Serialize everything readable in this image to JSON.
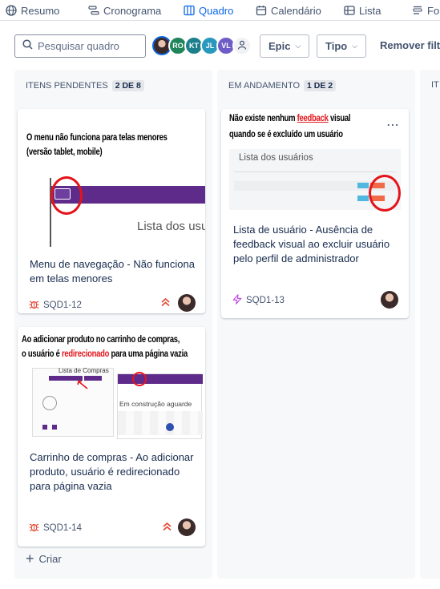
{
  "tabs": [
    {
      "label": "Resumo",
      "icon": "globe-icon"
    },
    {
      "label": "Cronograma",
      "icon": "timeline-icon"
    },
    {
      "label": "Quadro",
      "icon": "board-icon",
      "active": true
    },
    {
      "label": "Calendário",
      "icon": "calendar-icon"
    },
    {
      "label": "Lista",
      "icon": "list-icon"
    },
    {
      "label": "Form",
      "icon": "form-icon"
    }
  ],
  "filters": {
    "search_placeholder": "Pesquisar quadro",
    "avatars": [
      {
        "initials": "",
        "color": "#3b2a2a",
        "type": "photo"
      },
      {
        "initials": "RO",
        "color": "#1f845a"
      },
      {
        "initials": "KT",
        "color": "#1d7f8c"
      },
      {
        "initials": "JL",
        "color": "#2898bd"
      },
      {
        "initials": "VL",
        "color": "#6e5dc6"
      }
    ],
    "epic_label": "Epic",
    "tipo_label": "Tipo",
    "remover_label": "Remover filtr"
  },
  "columns": [
    {
      "title": "ITENS PENDENTES",
      "count": "2 DE 8",
      "create_label": "Criar",
      "cards": [
        {
          "thumb_line1": "O menu não funciona para telas menores",
          "thumb_line2": "(versão tablet, mobile)",
          "thumb_screen_text": "Lista dos usu",
          "title": "Menu de navegação - Não funciona em telas menores",
          "key": "SQD1-12",
          "type_icon": "bug-icon"
        },
        {
          "thumb_line1": "Ao adicionar produto no carrinho de compras,",
          "thumb_line2_a": "o usuário é ",
          "thumb_line2_red": "redirecionado",
          "thumb_line2_b": " para uma página vazia",
          "thumb_mini_title": "Lista de Compras",
          "thumb_mini_text": "Em construção aguarde",
          "title": "Carrinho de compras - Ao adicionar produto, usuário é redirecionado para página vazia",
          "key": "SQD1-14",
          "type_icon": "bug-icon"
        }
      ]
    },
    {
      "title": "EM ANDAMENTO",
      "count": "1 DE 2",
      "cards": [
        {
          "thumb_line1_a": "Não existe nenhum ",
          "thumb_line1_red": "feedback",
          "thumb_line1_b": " visual",
          "thumb_line2": "quando se é excluído um usuário",
          "thumb_screen_text": "Lista dos usuários",
          "title": "Lista de usuário - Ausência de feedback visual ao excluir usuário pelo perfil de administrador",
          "key": "SQD1-13",
          "type_icon": "lightning-icon"
        }
      ]
    },
    {
      "title": "IT"
    }
  ],
  "colors": {
    "accent": "#0c66e4",
    "bug": "#e34935",
    "story": "#a54800",
    "purple": "#5e2b8a"
  }
}
